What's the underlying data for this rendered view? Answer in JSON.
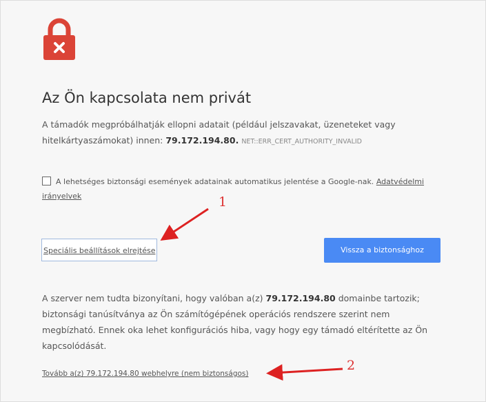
{
  "icons": {
    "lock": "lock-icon",
    "lock_bg_color": "#db4437",
    "close_mark": "×"
  },
  "heading": "Az Ön kapcsolata nem privát",
  "description": {
    "text": "A támadók megpróbálhatják ellopni adatait (például jelszavakat, üzeneteket vagy hitelkártyaszámokat) innen:",
    "host": "79.172.194.80.",
    "error_code": "NET::ERR_CERT_AUTHORITY_INVALID"
  },
  "report_checkbox": {
    "checked": false,
    "label": "A lehetséges biztonsági események adatainak automatikus jelentése a Google-nak.",
    "privacy_link": "Adatvédelmi irányelvek"
  },
  "buttons": {
    "advanced": "Speciális beállítások elrejtése",
    "back_to_safety": "Vissza a biztonsághoz",
    "back_color": "#4a8af4"
  },
  "details": {
    "part1": "A szerver nem tudta bizonyítani, hogy valóban a(z)",
    "domain": "79.172.194.80",
    "part2": "domainbe tartozik; biztonsági tanúsítványa az Ön számítógépének operációs rendszere szerint nem megbízható. Ennek oka lehet konfigurációs hiba, vagy hogy egy támadó eltérítette az Ön kapcsolódását."
  },
  "proceed_link": "Tovább a(z) 79.172.194.80 webhelyre (nem biztonságos)",
  "annotations": {
    "arrow1_label": "1",
    "arrow2_label": "2",
    "color": "#dd2222"
  }
}
